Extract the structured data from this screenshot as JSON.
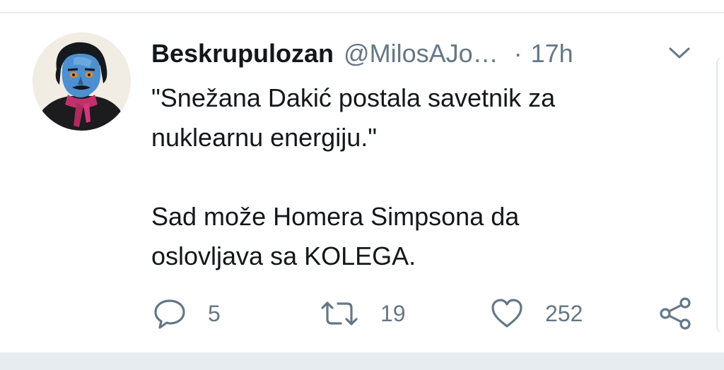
{
  "tweet": {
    "display_name": "Beskrupulozan",
    "handle": "@MilosAJo…",
    "separator": "·",
    "time": "17h",
    "text_lines": [
      "\"Snežana Dakić postala savetnik za",
      "nuklearnu energiju.\"",
      "Sad može Homera Simpsona da",
      "oslovljava sa KOLEGA."
    ]
  },
  "actions": {
    "reply_count": "5",
    "retweet_count": "19",
    "like_count": "252"
  },
  "icons": {
    "reply": "speech-bubble-icon",
    "retweet": "retweet-icon",
    "like": "heart-icon",
    "share": "share-icon",
    "more": "chevron-down-icon"
  },
  "colors": {
    "text": "#14171a",
    "secondary": "#657786",
    "divider": "#e6ecf0"
  }
}
